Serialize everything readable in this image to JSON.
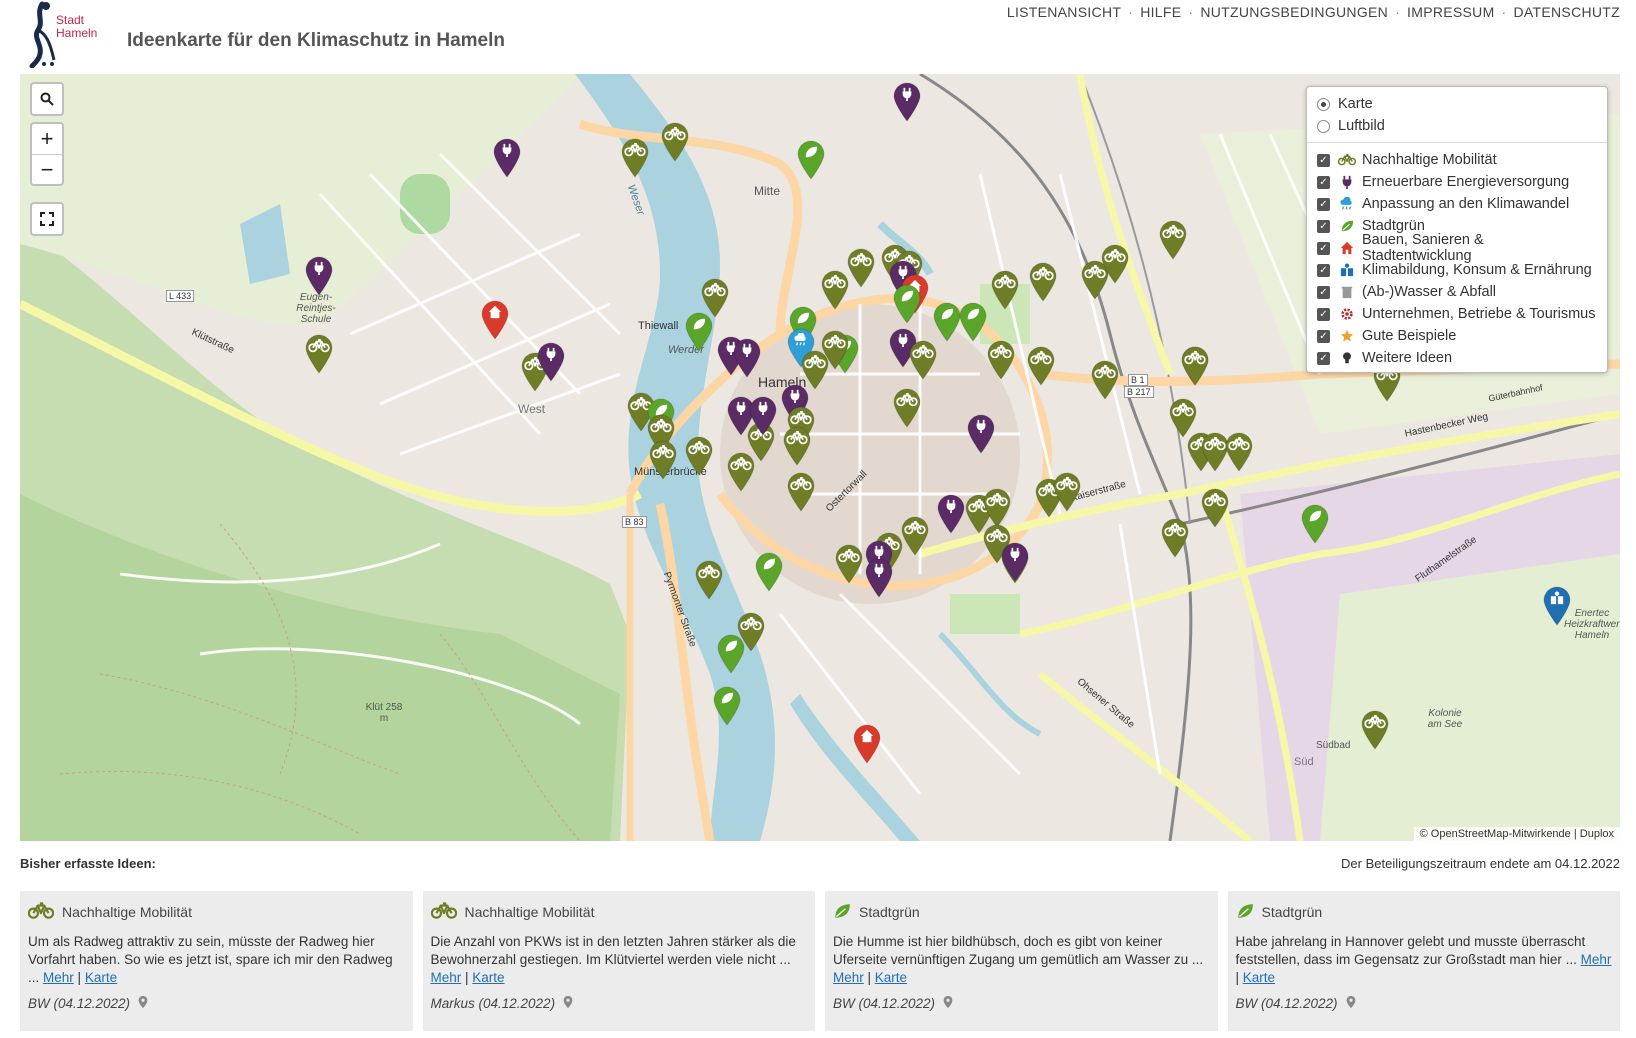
{
  "header": {
    "logo_text_line1": "Stadt",
    "logo_text_line2": "Hameln",
    "title": "Ideenkarte für den Klimaschutz in Hameln",
    "nav": [
      "LISTENANSICHT",
      "HILFE",
      "NUTZUNGSBEDINGUNGEN",
      "IMPRESSUM",
      "DATENSCHUTZ"
    ]
  },
  "map": {
    "controls": {
      "search": "search-icon",
      "zoom_in": "+",
      "zoom_out": "−",
      "fullscreen": "fullscreen-icon"
    },
    "base_layers": [
      {
        "label": "Karte",
        "selected": true
      },
      {
        "label": "Luftbild",
        "selected": false
      }
    ],
    "overlays": [
      {
        "label": "Nachhaltige Mobilität",
        "icon": "bicycle-icon",
        "color": "#6e7d26",
        "checked": true
      },
      {
        "label": "Erneuerbare Energieversorgung",
        "icon": "plug-icon",
        "color": "#5b2b66",
        "checked": true
      },
      {
        "label": "Anpassung an den Klimawandel",
        "icon": "cloud-rain-icon",
        "color": "#2f9fd8",
        "checked": true
      },
      {
        "label": "Stadtgrün",
        "icon": "leaf-icon",
        "color": "#5aa52a",
        "checked": true
      },
      {
        "label": "Bauen, Sanieren & Stadtentwicklung",
        "icon": "house-icon",
        "color": "#d93b2b",
        "checked": true
      },
      {
        "label": "Klimabildung, Konsum & Ernährung",
        "icon": "education-icon",
        "color": "#1f6fb2",
        "checked": true
      },
      {
        "label": "(Ab-)Wasser & Abfall",
        "icon": "trash-icon",
        "color": "#999999",
        "checked": true
      },
      {
        "label": "Unternehmen, Betriebe & Tourismus",
        "icon": "gear-icon",
        "color": "#b03030",
        "checked": true
      },
      {
        "label": "Gute Beispiele",
        "icon": "star-icon",
        "color": "#f0a030",
        "checked": true
      },
      {
        "label": "Weitere Ideen",
        "icon": "bulb-icon",
        "color": "#333333",
        "checked": true
      }
    ],
    "attribution": "© OpenStreetMap-Mitwirkende | Duplox",
    "labels": [
      "Mitte",
      "Hameln",
      "West",
      "Thiewall",
      "Werder",
      "Münsterbrücke",
      "Eugen-Reintjes-Schule",
      "Weser",
      "Klüt 258 m",
      "Kolonie am See",
      "Südbad",
      "Süd",
      "Enertec Heizkraftwerk Hameln",
      "Hastenbecker Weg",
      "Klütstraße",
      "Kaiserstraße",
      "Pyrmonter Straße",
      "Ostertorwall",
      "Fluthamelstraße",
      "Ohsener Straße",
      "Güterbahnhof",
      "B 83",
      "B 1",
      "B 217",
      "L 433"
    ]
  },
  "list": {
    "heading": "Bisher erfasste Ideen:",
    "period_note": "Der Beteiligungszeitraum endete am 04.12.2022",
    "more_label": "Mehr",
    "map_label": "Karte",
    "cards": [
      {
        "category": "Nachhaltige Mobilität",
        "icon": "bicycle-icon",
        "text": "Um als Radweg attraktiv zu sein, müsste der Radweg hier Vorfahrt haben. So wie es jetzt ist, spare ich mir den Radweg ...",
        "author": "BW (04.12.2022)"
      },
      {
        "category": "Nachhaltige Mobilität",
        "icon": "bicycle-icon",
        "text": "Die Anzahl von PKWs ist in den letzten Jahren stärker als die Bewohnerzahl gestiegen. Im Klütviertel werden viele nicht ...",
        "author": "Markus (04.12.2022)"
      },
      {
        "category": "Stadtgrün",
        "icon": "leaf-icon",
        "text": "Die Humme ist hier bildhübsch, doch es gibt von keiner Uferseite vernünftigen Zugang um gemütlich am Wasser zu ...",
        "author": "BW (04.12.2022)"
      },
      {
        "category": "Stadtgrün",
        "icon": "leaf-icon",
        "text": "Habe jahrelang in Hannover gelebt und musste überrascht feststellen, dass im Gegensatz zur Großstadt man hier ...",
        "author": "BW (04.12.2022)"
      }
    ]
  },
  "colors": {
    "mobility": "#6e7d26",
    "energy": "#5b2b66",
    "green": "#5aa52a",
    "building": "#d93b2b",
    "climate": "#2f9fd8",
    "education": "#1f6fb2",
    "link": "#1f6fb2"
  }
}
